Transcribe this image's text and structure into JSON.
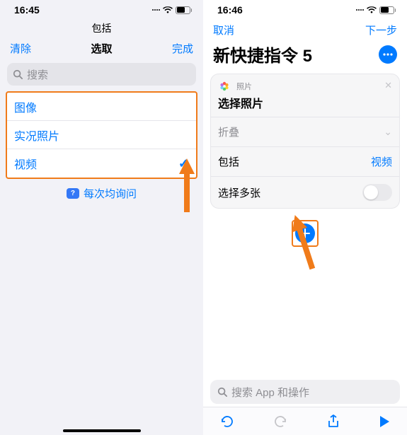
{
  "left": {
    "time": "16:45",
    "supertitle": "包括",
    "clear": "清除",
    "title": "选取",
    "done": "完成",
    "search_placeholder": "搜索",
    "options": [
      {
        "label": "图像",
        "selected": false
      },
      {
        "label": "实况照片",
        "selected": false
      },
      {
        "label": "视频",
        "selected": true
      }
    ],
    "ask_each": "每次均询问"
  },
  "right": {
    "time": "16:46",
    "cancel": "取消",
    "next": "下一步",
    "title": "新快捷指令 5",
    "card": {
      "app_name": "照片",
      "action": "选择照片",
      "rows": {
        "collapse": "折叠",
        "include_label": "包括",
        "include_value": "视频",
        "multi_label": "选择多张",
        "multi_on": false
      }
    },
    "search_placeholder": "搜索 App 和操作"
  },
  "colors": {
    "accent": "#007aff",
    "highlight": "#f07b1a"
  }
}
